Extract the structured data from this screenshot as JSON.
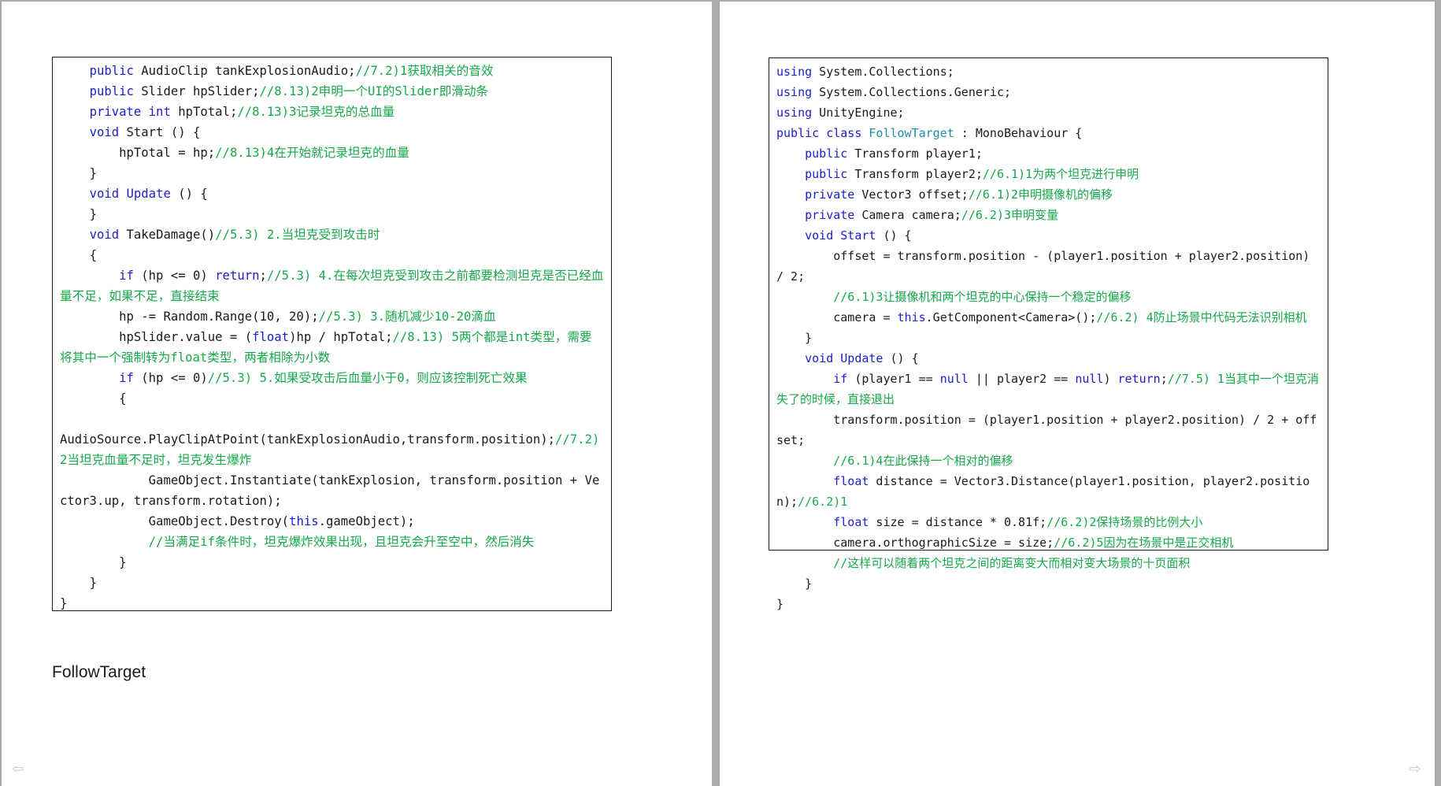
{
  "left_page": {
    "code_lines": [
      [
        {
          "t": "    "
        },
        {
          "t": "public",
          "c": "kw"
        },
        {
          "t": " AudioClip tankExplosionAudio;"
        },
        {
          "t": "//7.2)1获取相关的音效",
          "c": "cm"
        }
      ],
      [
        {
          "t": "    "
        },
        {
          "t": "public",
          "c": "kw"
        },
        {
          "t": " Slider hpSlider;"
        },
        {
          "t": "//8.13)2申明一个UI的Slider即滑动条",
          "c": "cm"
        }
      ],
      [
        {
          "t": "    "
        },
        {
          "t": "private",
          "c": "kw"
        },
        {
          "t": " "
        },
        {
          "t": "int",
          "c": "kw"
        },
        {
          "t": " hpTotal;"
        },
        {
          "t": "//8.13)3记录坦克的总血量",
          "c": "cm"
        }
      ],
      [
        {
          "t": "    "
        },
        {
          "t": "void",
          "c": "kw"
        },
        {
          "t": " Start () {"
        }
      ],
      [
        {
          "t": "        hpTotal = hp;"
        },
        {
          "t": "//8.13)4在开始就记录坦克的血量",
          "c": "cm"
        }
      ],
      [
        {
          "t": "    }"
        }
      ],
      [
        {
          "t": "    "
        },
        {
          "t": "void",
          "c": "kw"
        },
        {
          "t": " "
        },
        {
          "t": "Update",
          "c": "kw"
        },
        {
          "t": " () {"
        }
      ],
      [
        {
          "t": "    }"
        }
      ],
      [
        {
          "t": "    "
        },
        {
          "t": "void",
          "c": "kw"
        },
        {
          "t": " TakeDamage()"
        },
        {
          "t": "//5.3) 2.当坦克受到攻击时",
          "c": "cm"
        }
      ],
      [
        {
          "t": "    {"
        }
      ],
      [
        {
          "t": "        "
        },
        {
          "t": "if",
          "c": "kw"
        },
        {
          "t": " (hp <= 0) "
        },
        {
          "t": "return",
          "c": "kw"
        },
        {
          "t": ";"
        },
        {
          "t": "//5.3) 4.在每次坦克受到攻击之前都要检测坦克是否已经血量不足，如果不足，直接结束",
          "c": "cm"
        }
      ],
      [
        {
          "t": "        hp -= Random.Range(10, 20);"
        },
        {
          "t": "//5.3) 3.随机减少10-20滴血",
          "c": "cm"
        }
      ],
      [
        {
          "t": "        hpSlider.value = ("
        },
        {
          "t": "float",
          "c": "kw"
        },
        {
          "t": ")hp / hpTotal;"
        },
        {
          "t": "//8.13) 5两个都是int类型，需要将其中一个强制转为float类型，两者相除为小数",
          "c": "cm"
        }
      ],
      [
        {
          "t": "        "
        },
        {
          "t": "if",
          "c": "kw"
        },
        {
          "t": " (hp <= 0)"
        },
        {
          "t": "//5.3) 5.如果受攻击后血量小于0，则应该控制死亡效果",
          "c": "cm"
        }
      ],
      [
        {
          "t": "        {"
        }
      ],
      [
        {
          "t": ""
        }
      ],
      [
        {
          "t": "AudioSource.PlayClipAtPoint(tankExplosionAudio,transform.position);"
        },
        {
          "t": "//7.2) 2当坦克血量不足时，坦克发生爆炸",
          "c": "cm"
        }
      ],
      [
        {
          "t": "            GameObject.Instantiate(tankExplosion, transform.position + Vector3.up, transform.rotation);"
        }
      ],
      [
        {
          "t": "            GameObject.Destroy("
        },
        {
          "t": "this",
          "c": "kw"
        },
        {
          "t": ".gameObject);"
        }
      ],
      [
        {
          "t": "            "
        },
        {
          "t": "//当满足if条件时，坦克爆炸效果出现，且坦克会升至空中，然后消失",
          "c": "cm"
        }
      ],
      [
        {
          "t": "        }"
        }
      ],
      [
        {
          "t": "    }"
        }
      ],
      [
        {
          "t": "}"
        }
      ]
    ],
    "heading": "FollowTarget"
  },
  "right_page": {
    "code_lines": [
      [
        {
          "t": "using",
          "c": "kw"
        },
        {
          "t": " System.Collections;"
        }
      ],
      [
        {
          "t": "using",
          "c": "kw"
        },
        {
          "t": " System.Collections.Generic;"
        }
      ],
      [
        {
          "t": "using",
          "c": "kw"
        },
        {
          "t": " UnityEngine;"
        }
      ],
      [
        {
          "t": "public",
          "c": "kw"
        },
        {
          "t": " "
        },
        {
          "t": "class",
          "c": "kw"
        },
        {
          "t": " "
        },
        {
          "t": "FollowTarget",
          "c": "cls"
        },
        {
          "t": " : MonoBehaviour {"
        }
      ],
      [
        {
          "t": "    "
        },
        {
          "t": "public",
          "c": "kw"
        },
        {
          "t": " Transform player1;"
        }
      ],
      [
        {
          "t": "    "
        },
        {
          "t": "public",
          "c": "kw"
        },
        {
          "t": " Transform player2;"
        },
        {
          "t": "//6.1)1为两个坦克进行申明",
          "c": "cm"
        }
      ],
      [
        {
          "t": "    "
        },
        {
          "t": "private",
          "c": "kw"
        },
        {
          "t": " Vector3 offset;"
        },
        {
          "t": "//6.1)2申明摄像机的偏移",
          "c": "cm"
        }
      ],
      [
        {
          "t": "    "
        },
        {
          "t": "private",
          "c": "kw"
        },
        {
          "t": " Camera camera;"
        },
        {
          "t": "//6.2)3申明变量",
          "c": "cm"
        }
      ],
      [
        {
          "t": "    "
        },
        {
          "t": "void",
          "c": "kw"
        },
        {
          "t": " "
        },
        {
          "t": "Start",
          "c": "kw"
        },
        {
          "t": " () {"
        }
      ],
      [
        {
          "t": "        offset = transform.position - (player1.position + player2.position) / 2;"
        }
      ],
      [
        {
          "t": "        "
        },
        {
          "t": "//6.1)3让摄像机和两个坦克的中心保持一个稳定的偏移",
          "c": "cm"
        }
      ],
      [
        {
          "t": "        camera = "
        },
        {
          "t": "this",
          "c": "kw"
        },
        {
          "t": ".GetComponent<Camera>();"
        },
        {
          "t": "//6.2) 4防止场景中代码无法识别相机",
          "c": "cm"
        }
      ],
      [
        {
          "t": "    }"
        }
      ],
      [
        {
          "t": "    "
        },
        {
          "t": "void",
          "c": "kw"
        },
        {
          "t": " "
        },
        {
          "t": "Update",
          "c": "kw"
        },
        {
          "t": " () {"
        }
      ],
      [
        {
          "t": "        "
        },
        {
          "t": "if",
          "c": "kw"
        },
        {
          "t": " (player1 == "
        },
        {
          "t": "null",
          "c": "kw"
        },
        {
          "t": " || player2 == "
        },
        {
          "t": "null",
          "c": "kw"
        },
        {
          "t": ") "
        },
        {
          "t": "return",
          "c": "kw"
        },
        {
          "t": ";"
        },
        {
          "t": "//7.5) 1当其中一个坦克消失了的时候，直接退出",
          "c": "cm"
        }
      ],
      [
        {
          "t": "        transform.position = (player1.position + player2.position) / 2 + offset;"
        }
      ],
      [
        {
          "t": "        "
        },
        {
          "t": "//6.1)4在此保持一个相对的偏移",
          "c": "cm"
        }
      ],
      [
        {
          "t": "        "
        },
        {
          "t": "float",
          "c": "kw"
        },
        {
          "t": " distance = Vector3.Distance(player1.position, player2.position);"
        },
        {
          "t": "//6.2)1",
          "c": "cm"
        }
      ],
      [
        {
          "t": "        "
        },
        {
          "t": "float",
          "c": "kw"
        },
        {
          "t": " size = distance * 0.81f;"
        },
        {
          "t": "//6.2)2保持场景的比例大小",
          "c": "cm"
        }
      ],
      [
        {
          "t": "        camera.orthographicSize = size;"
        },
        {
          "t": "//6.2)5因为在场景中是正交相机",
          "c": "cm"
        }
      ],
      [
        {
          "t": "        "
        },
        {
          "t": "//这样可以随着两个坦克之间的距离变大而相对变大场景的十页面积",
          "c": "cm"
        }
      ],
      [
        {
          "t": "    }"
        }
      ],
      [
        {
          "t": "}"
        }
      ]
    ]
  },
  "navigation": {
    "prev_icon": "arrow-left-icon",
    "next_icon": "arrow-right-icon",
    "prev_glyph": "⇦",
    "next_glyph": "⇨"
  }
}
